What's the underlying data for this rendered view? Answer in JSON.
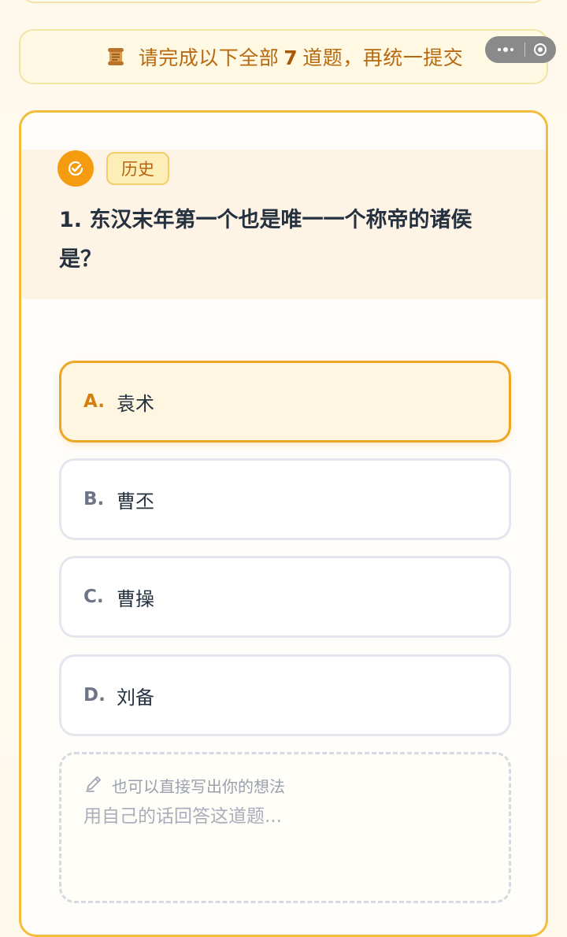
{
  "notice": {
    "prefix": "请完成以下全部",
    "count": "7",
    "suffix": "道题，再统一提交",
    "icon": "scroll-icon"
  },
  "capsule": {
    "more_icon": "more-dots-icon",
    "close_icon": "target-icon"
  },
  "question": {
    "status_icon": "check-circle-icon",
    "status_color": "#f59b10",
    "category": "历史",
    "title": "1. 东汉末年第一个也是唯一一个称帝的诸侯是？",
    "selected": "A",
    "options": [
      {
        "letter": "A.",
        "text": "袁术"
      },
      {
        "letter": "B.",
        "text": "曹丕"
      },
      {
        "letter": "C.",
        "text": "曹操"
      },
      {
        "letter": "D.",
        "text": "刘备"
      }
    ]
  },
  "free_answer": {
    "icon": "pencil-icon",
    "label": "也可以直接写出你的想法",
    "placeholder": "用自己的话回答这道题...",
    "value": ""
  },
  "colors": {
    "accent": "#f59b10",
    "card_border": "#f2bd3a",
    "notice_text": "#b8690f"
  }
}
